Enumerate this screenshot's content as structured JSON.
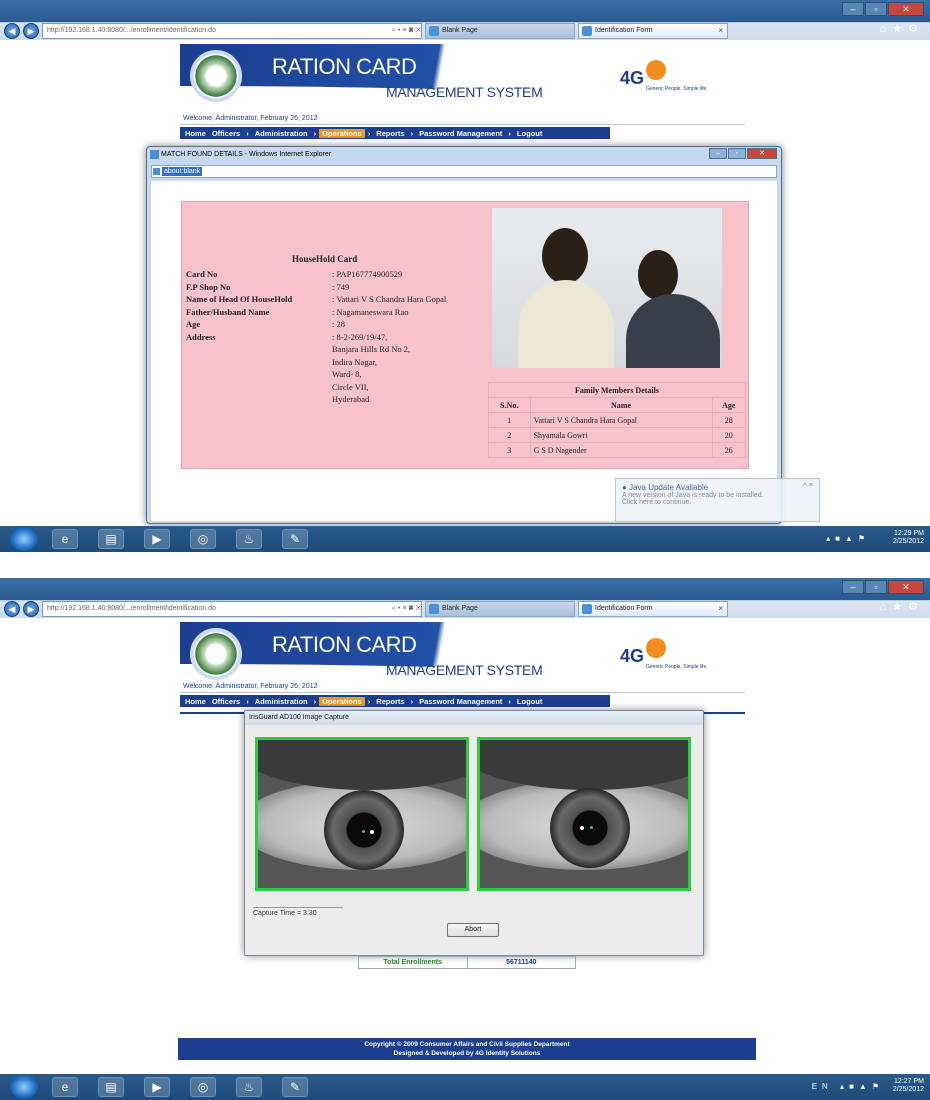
{
  "browser": {
    "address": "http://192.168.1.40:8080/.../enrollment/identification.do",
    "address_controls": "⌕ ▾ ≡ ✖ ✕",
    "tab_blank": "Blank Page",
    "tab_active": "Identification Form"
  },
  "header": {
    "title_line1": "RATION CARD",
    "title_line2": "MANAGEMENT SYSTEM",
    "brand": "4G",
    "brand_tag": "Generic People. Simple life.",
    "welcome": "Welcome, Administrator,  February 26, 2012"
  },
  "menu": {
    "home": "Home",
    "officers": "Officers",
    "administration": "Administration",
    "operations": "Operations",
    "reports": "Reports",
    "password": "Password Management",
    "logout": "Logout",
    "sep": "›"
  },
  "popup1": {
    "title": "MATCH FOUND DETAILS - Windows Internet Explorer",
    "address": "about:blank",
    "card_header": "HouseHold Card",
    "fields": [
      {
        "label": "Card No",
        "value": ": PAP167774900529"
      },
      {
        "label": "F.P Shop No",
        "value": ": 749"
      },
      {
        "label": "Name of Head Of HouseHold",
        "value": ": Vattari V S Chandra Hara Gopal"
      },
      {
        "label": "Father/Husband Name",
        "value": ": Nagamaneswara Rao"
      },
      {
        "label": "Age",
        "value": ": 28"
      },
      {
        "label": "Address",
        "value": ": 8-2-269/19/47,"
      },
      {
        "label": "",
        "value": "Banjara Hills Rd No 2,"
      },
      {
        "label": "",
        "value": "Indira Nagar,"
      },
      {
        "label": "",
        "value": "Ward- 8,"
      },
      {
        "label": "",
        "value": "Circle VII,"
      },
      {
        "label": "",
        "value": "Hyderabad"
      }
    ],
    "family_caption": "Family Members Details",
    "family_headers": [
      "S.No.",
      "Name",
      "Age"
    ],
    "family_rows": [
      {
        "sno": "1",
        "name": "Vattari V S Chandra Hara Gopal",
        "age": "28"
      },
      {
        "sno": "2",
        "name": "Shyamala Gowri",
        "age": "20"
      },
      {
        "sno": "3",
        "name": "G S D Nagender",
        "age": "26"
      }
    ]
  },
  "java_notice": {
    "title": "Java Update Available",
    "line1": "A new version of Java is ready to be installed.",
    "line2": "Click here to continue.",
    "controls": "˄  ×"
  },
  "taskbar1": {
    "time": "12:29 PM",
    "date": "2/25/2012"
  },
  "taskbar2": {
    "time": "12:27 PM",
    "date": "2/25/2012",
    "lang": "EN"
  },
  "popup2": {
    "title": "IrisGuard AD100 Image Capture",
    "capture_time": "Capture Time = 3.30",
    "abort": "Abort"
  },
  "enrollments": {
    "label": "Total Enrollments",
    "value": "56711140"
  },
  "footer": {
    "line1": "Copyright © 2009 Consumer Affairs and Civil Supplies Department",
    "line2": "Designed & Developed by 4G Identity Solutions"
  },
  "icons": {
    "back": "back-icon",
    "forward": "forward-icon",
    "start": "windows-start-icon",
    "ie": "internet-explorer-icon",
    "folder": "folder-icon",
    "media": "media-player-icon",
    "java": "java-icon"
  },
  "colors": {
    "brand_blue": "#1b3e8f",
    "menu_selected": "#f0951d",
    "card_pink": "#f7c2cc",
    "iris_frame": "#2ecc40"
  }
}
